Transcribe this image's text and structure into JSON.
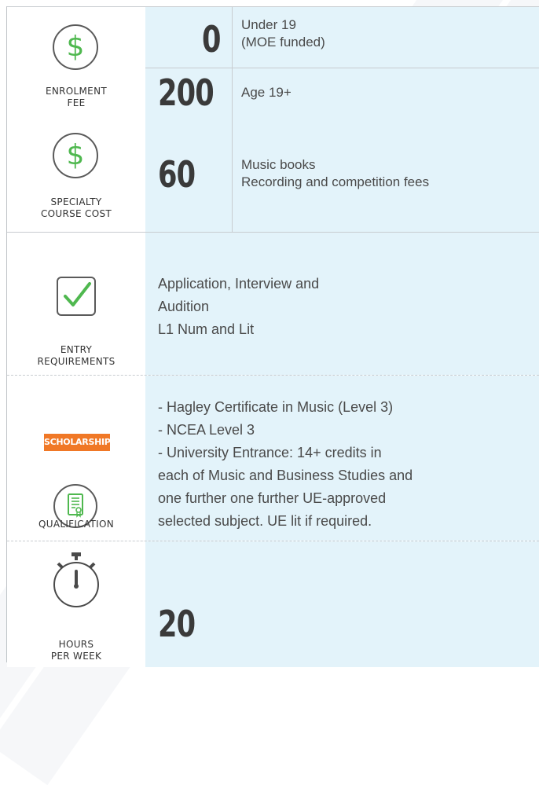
{
  "enrolment": {
    "label_line1": "ENROLMENT",
    "label_line2": "FEE",
    "icon": "dollar-icon",
    "fees": [
      {
        "amount": "0",
        "line1": "Under 19",
        "line2": "(MOE funded)"
      },
      {
        "amount": "200",
        "line1": "Age 19+",
        "line2": ""
      }
    ]
  },
  "specialty": {
    "label_line1": "SPECIALTY",
    "label_line2": "COURSE COST",
    "icon": "dollar-icon",
    "amount": "60",
    "line1": "Music books",
    "line2": "Recording and competition fees"
  },
  "entry": {
    "label_line1": "ENTRY",
    "label_line2": "REQUIREMENTS",
    "icon": "checkbox-icon",
    "lines": [
      "Application, Interview and",
      "Audition",
      "L1 Num and Lit"
    ]
  },
  "qualification": {
    "label": "QUALIFICATION",
    "badge": "SCHOLARSHIP",
    "icon": "certificate-icon",
    "lines": [
      "- Hagley Certificate in Music (Level 3)",
      "- NCEA Level 3",
      "- University Entrance: 14+ credits in",
      "each of Music and Business Studies and",
      "one further one further UE-approved",
      "selected subject. UE lit if required."
    ]
  },
  "hours": {
    "label_line1": "HOURS",
    "label_line2": "PER WEEK",
    "icon": "stopwatch-icon",
    "value": "20"
  },
  "colors": {
    "accent_green": "#4fb84f",
    "badge_orange": "#f07826",
    "cell_blue": "#e3f3fa"
  }
}
